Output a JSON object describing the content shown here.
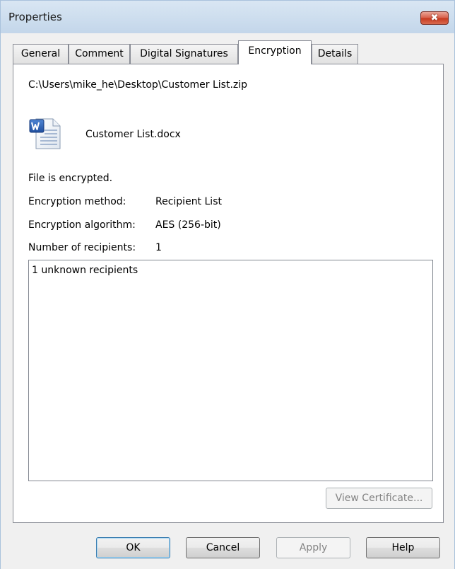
{
  "window": {
    "title": "Properties",
    "close_glyph": "✖"
  },
  "tabs": [
    {
      "label": "General"
    },
    {
      "label": "Comment"
    },
    {
      "label": "Digital Signatures"
    },
    {
      "label": "Encryption"
    },
    {
      "label": "Details"
    }
  ],
  "encryption": {
    "archive_path": "C:\\Users\\mike_he\\Desktop\\Customer List.zip",
    "file_name": "Customer List.docx",
    "file_icon": "word-document-icon",
    "status": "File is encrypted.",
    "method_label": "Encryption method:",
    "method_value": "Recipient List",
    "algorithm_label": "Encryption algorithm:",
    "algorithm_value": "AES (256-bit)",
    "recipients_label": "Number of recipients:",
    "recipients_value": "1",
    "recipients_list": [
      "1 unknown recipients"
    ],
    "view_certificate_label": "View Certificate..."
  },
  "buttons": {
    "ok": "OK",
    "cancel": "Cancel",
    "apply": "Apply",
    "help": "Help"
  },
  "colors": {
    "titlebar": "#cfdfef",
    "close_button": "#c7391f",
    "dialog_background": "#f0f0f0",
    "default_button_border": "#3c7fb1"
  }
}
